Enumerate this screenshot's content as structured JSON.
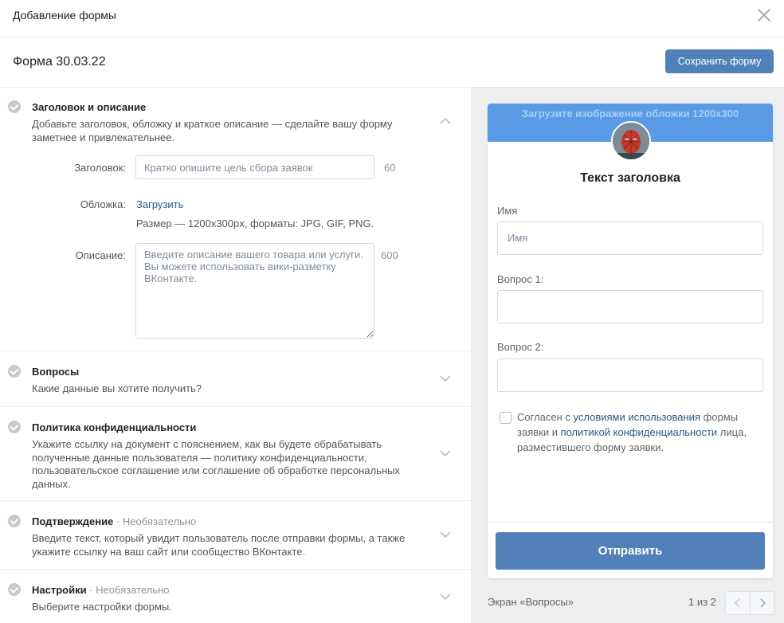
{
  "modal": {
    "title": "Добавление формы"
  },
  "form": {
    "name": "Форма 30.03.22",
    "save_label": "Сохранить форму"
  },
  "sections": [
    {
      "title": "Заголовок и описание",
      "optional": "",
      "desc": "Добавьте заголовок, обложку и краткое описание — сделайте вашу форму заметнее и привлекательнее."
    },
    {
      "title": "Вопросы",
      "optional": "",
      "desc": "Какие данные вы хотите получить?"
    },
    {
      "title": "Политика конфиденциальности",
      "optional": "",
      "desc": "Укажите ссылку на документ с пояснением, как вы будете обрабатывать полученные данные пользователя — политику конфиденциальности, пользовательское соглашение или соглашение об обработке персональных данных."
    },
    {
      "title": "Подтверждение",
      "optional": "Необязательно",
      "desc": "Введите текст, который увидит пользователь после отправки формы, а также укажите ссылку на ваш сайт или сообщество ВКонтакте."
    },
    {
      "title": "Настройки",
      "optional": "Необязательно",
      "desc": "Выберите настройки формы."
    }
  ],
  "fields": {
    "heading_label": "Заголовок:",
    "heading_placeholder": "Кратко опишите цель сбора заявок",
    "heading_counter": "60",
    "cover_label": "Обложка:",
    "cover_link": "Загрузить",
    "cover_hint": "Размер — 1200x300px, форматы: JPG, GIF, PNG.",
    "desc_label": "Описание:",
    "desc_placeholder": "Введите описание вашего товара или услуги. Вы можете использовать вики-разметку ВКонтакте.",
    "desc_counter": "600"
  },
  "preview": {
    "cover_text": "Загрузите изображение обложки 1200x300",
    "title": "Текст заголовка",
    "q1_label": "Имя",
    "q1_placeholder": "Имя",
    "q2_label": "Вопрос 1:",
    "q3_label": "Вопрос 2:",
    "consent_1": "Согласен с ",
    "consent_link1": "условиями использования",
    "consent_2": " формы заявки и ",
    "consent_link2": "политикой конфиденциальности",
    "consent_3": " лица, разместившего форму заявки.",
    "submit_label": "Отправить"
  },
  "footer": {
    "screen_label": "Экран «Вопросы»",
    "page_count": "1 из 2"
  },
  "colors": {
    "accent": "#5181b8",
    "cover": "#5b9be6",
    "link": "#2a5885"
  }
}
